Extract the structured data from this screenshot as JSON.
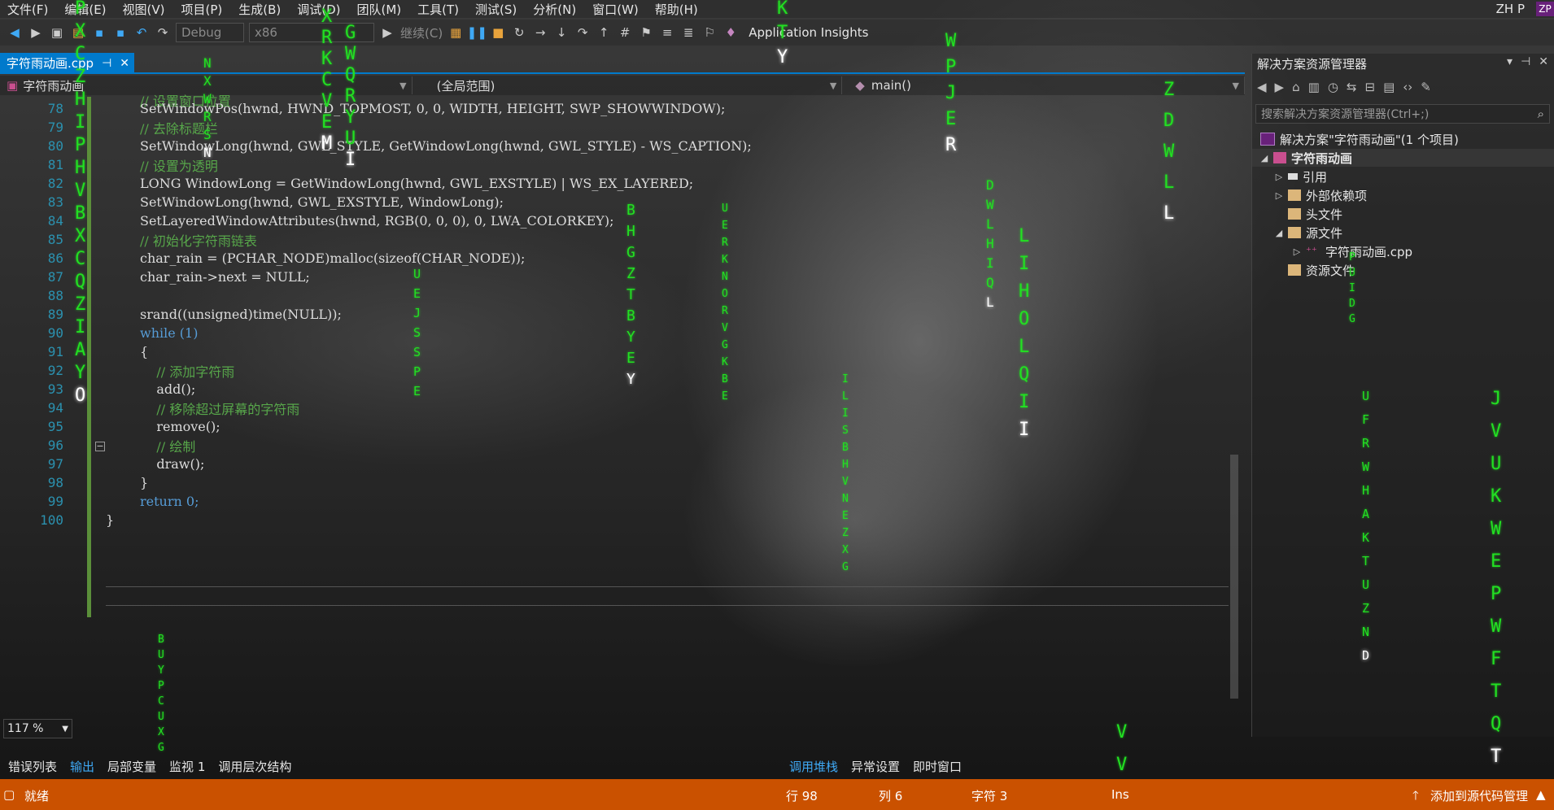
{
  "menubar": {
    "items": [
      "文件(F)",
      "编辑(E)",
      "视图(V)",
      "项目(P)",
      "生成(B)",
      "调试(D)",
      "团队(M)",
      "工具(T)",
      "测试(S)",
      "分析(N)",
      "窗口(W)",
      "帮助(H)"
    ],
    "user_initials": "ZH P",
    "user_badge": "ZP"
  },
  "toolbar": {
    "config": "Debug",
    "platform": "x86",
    "continue_label": "继续(C)",
    "insights_label": "Application Insights"
  },
  "document_tab": {
    "filename": "字符雨动画.cpp"
  },
  "navbar": {
    "project": "字符雨动画",
    "scope": "(全局范围)",
    "member": "main()"
  },
  "editor": {
    "first_line_fragment": "// 设置窗口位置",
    "lines": [
      {
        "n": "78",
        "text": "SetWindowPos(hwnd, HWND_TOPMOST, 0, 0, WIDTH, HEIGHT, SWP_SHOWWINDOW);"
      },
      {
        "n": "79",
        "text": "// 去除标题栏"
      },
      {
        "n": "80",
        "text": "SetWindowLong(hwnd, GWL_STYLE, GetWindowLong(hwnd, GWL_STYLE) - WS_CAPTION);"
      },
      {
        "n": "81",
        "text": "// 设置为透明"
      },
      {
        "n": "82",
        "text": "LONG WindowLong = GetWindowLong(hwnd, GWL_EXSTYLE) | WS_EX_LAYERED;"
      },
      {
        "n": "83",
        "text": "SetWindowLong(hwnd, GWL_EXSTYLE, WindowLong);"
      },
      {
        "n": "84",
        "text": "SetLayeredWindowAttributes(hwnd, RGB(0, 0, 0), 0, LWA_COLORKEY);"
      },
      {
        "n": "85",
        "text": "// 初始化字符雨链表"
      },
      {
        "n": "86",
        "text": "char_rain = (PCHAR_NODE)malloc(sizeof(CHAR_NODE));"
      },
      {
        "n": "87",
        "text": "char_rain->next = NULL;"
      },
      {
        "n": "88",
        "text": ""
      },
      {
        "n": "89",
        "text": "srand((unsigned)time(NULL));"
      },
      {
        "n": "90",
        "text": "while (1)"
      },
      {
        "n": "91",
        "text": "{"
      },
      {
        "n": "92",
        "text": "    // 添加字符雨"
      },
      {
        "n": "93",
        "text": "    add();"
      },
      {
        "n": "94",
        "text": "    // 移除超过屏幕的字符雨"
      },
      {
        "n": "95",
        "text": "    remove();"
      },
      {
        "n": "96",
        "text": "    // 绘制"
      },
      {
        "n": "97",
        "text": "    draw();"
      },
      {
        "n": "98",
        "text": "}"
      },
      {
        "n": "99",
        "text": "return 0;"
      },
      {
        "n": "100",
        "text": "}"
      }
    ],
    "zoom": "117 %"
  },
  "solution_explorer": {
    "title": "解决方案资源管理器",
    "search_placeholder": "搜索解决方案资源管理器(Ctrl+;)",
    "tree": [
      {
        "label": "解决方案\"字符雨动画\"(1 个项目)",
        "icon": "solution"
      },
      {
        "label": "字符雨动画",
        "icon": "project"
      },
      {
        "label": "引用",
        "icon": "references"
      },
      {
        "label": "外部依赖项",
        "icon": "folder"
      },
      {
        "label": "头文件",
        "icon": "folder"
      },
      {
        "label": "源文件",
        "icon": "folder"
      },
      {
        "label": "字符雨动画.cpp",
        "icon": "cpp-file"
      },
      {
        "label": "资源文件",
        "icon": "folder"
      }
    ]
  },
  "bottom_tabs": {
    "left": [
      "错误列表",
      "输出",
      "局部变量",
      "监视 1",
      "调用层次结构"
    ],
    "right": [
      "调用堆栈",
      "异常设置",
      "即时窗口"
    ]
  },
  "status": {
    "ready": "就绪",
    "row": "行 98",
    "col": "列 6",
    "char": "字符 3",
    "mode": "Ins",
    "source_control": "添加到源代码管理"
  },
  "matrix_rain": [
    {
      "col": "A",
      "text": "PXCZHIPHVBXCQZIAY",
      "head": "O"
    },
    {
      "col": "B",
      "text": "XRKCVE",
      "head": "M"
    },
    {
      "col": "C",
      "text": "GWQRYU",
      "head": "I"
    },
    {
      "col": "D",
      "text": "NXWRS",
      "head": "N"
    },
    {
      "col": "E",
      "text": "UEJSSPE",
      "head": ""
    },
    {
      "col": "F",
      "text": "BHGZTBYE",
      "head": "Y"
    },
    {
      "col": "G",
      "text": "KT",
      "head": "Y"
    },
    {
      "col": "H",
      "text": "WPJE",
      "head": "R"
    },
    {
      "col": "I",
      "text": "DWLHIQ",
      "head": "L"
    },
    {
      "col": "J",
      "text": "LIHOLQI",
      "head": "I"
    },
    {
      "col": "K",
      "text": "ZDWL",
      "head": "L"
    },
    {
      "col": "L",
      "text": "JVUKWEPWFTQ",
      "head": "T"
    },
    {
      "col": "M",
      "text": "UFRWHAKTUZN",
      "head": "D"
    },
    {
      "col": "N",
      "text": "UERKNORVGKBE",
      "head": ""
    },
    {
      "col": "O",
      "text": "ILISBHVNEZXG",
      "head": ""
    },
    {
      "col": "P",
      "text": "BUYPCUXG",
      "head": ""
    },
    {
      "col": "Q",
      "text": "VV",
      "head": ""
    },
    {
      "col": "R",
      "text": "PUIDG",
      "head": ""
    }
  ]
}
